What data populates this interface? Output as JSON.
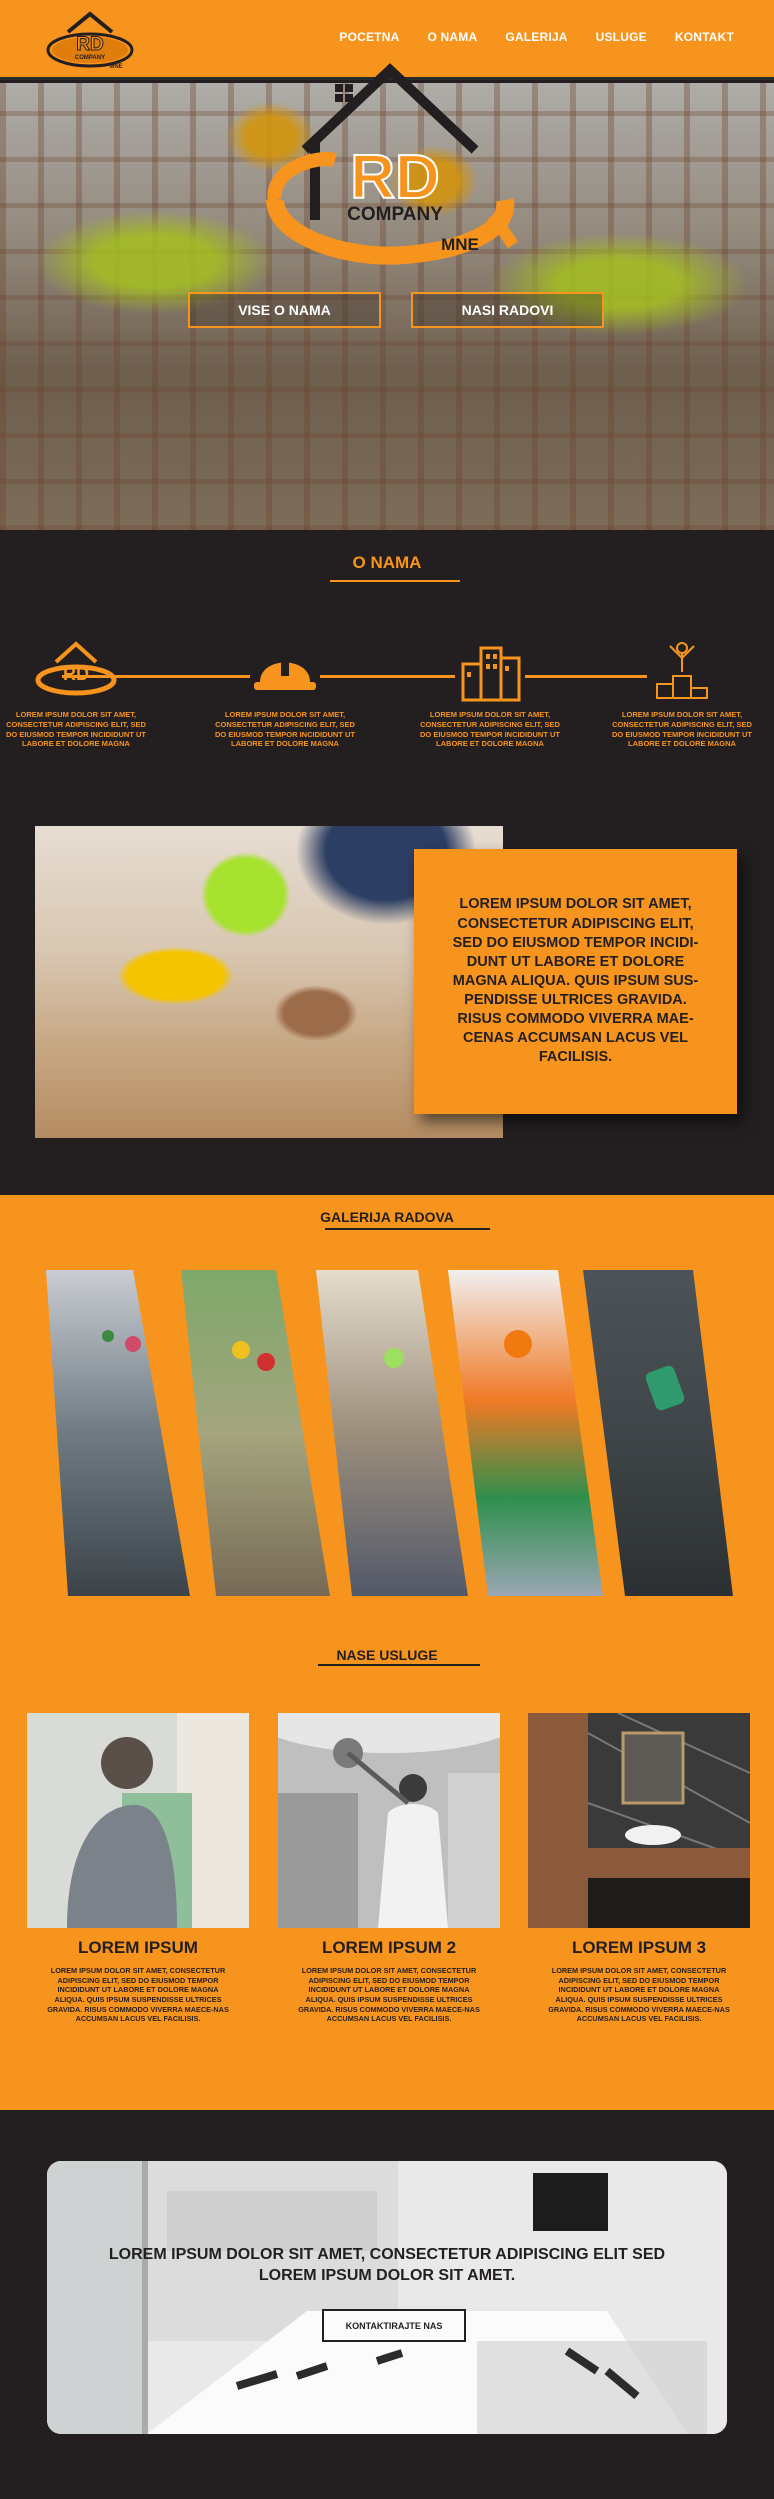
{
  "brand": {
    "logo_letters": "RD",
    "logo_word": "COMPANY",
    "logo_suffix": "MNE",
    "accent": "#f7941d",
    "dark": "#231f20"
  },
  "nav": {
    "items": [
      "POCETNA",
      "O NAMA",
      "GALERIJA",
      "USLUGE",
      "KONTAKT"
    ]
  },
  "hero": {
    "button_about": "VISE O NAMA",
    "button_work": "NASI RADOVI"
  },
  "about": {
    "title": "O NAMA",
    "features": [
      {
        "icon": "rd-logo-icon",
        "text": "LOREM IPSUM DOLOR SIT AMET, CONSECTETUR ADIPISCING ELIT, SED DO EIUSMOD TEMPOR INCIDIDUNT UT LABORE ET DOLORE MAGNA"
      },
      {
        "icon": "hard-hat-icon",
        "text": "LOREM IPSUM DOLOR SIT AMET, CONSECTETUR ADIPISCING ELIT, SED DO EIUSMOD TEMPOR INCIDIDUNT UT LABORE ET DOLORE MAGNA"
      },
      {
        "icon": "buildings-icon",
        "text": "LOREM IPSUM DOLOR SIT AMET, CONSECTETUR ADIPISCING ELIT, SED DO EIUSMOD TEMPOR INCIDIDUNT UT LABORE ET DOLORE MAGNA"
      },
      {
        "icon": "winner-podium-icon",
        "text": "LOREM IPSUM DOLOR SIT AMET, CONSECTETUR ADIPISCING ELIT, SED DO EIUSMOD TEMPOR INCIDIDUNT UT LABORE ET DOLORE MAGNA"
      }
    ],
    "highlight_text": "LOREM IPSUM DOLOR SIT AMET, CONSECTETUR ADIPISCING ELIT, SED DO EIUSMOD TEMPOR INCIDI-DUNT UT LABORE ET DOLORE MAGNA ALIQUA. QUIS IPSUM SUS-PENDISSE ULTRICES GRAVIDA. RISUS COMMODO VIVERRA MAE-CENAS ACCUMSAN LACUS VEL FACILISIS."
  },
  "gallery": {
    "title": "GALERIJA RADOVA"
  },
  "services": {
    "title": "NASE USLUGE",
    "items": [
      {
        "title": "LOREM IPSUM",
        "text": "LOREM IPSUM DOLOR SIT AMET, CONSECTETUR ADIPISCING ELIT, SED DO EIUSMOD TEMPOR INCIDIDUNT UT LABORE ET DOLORE MAGNA ALIQUA. QUIS IPSUM SUSPENDISSE ULTRICES GRAVIDA. RISUS COMMODO VIVERRA MAECE-NAS ACCUMSAN LACUS VEL FACILISIS."
      },
      {
        "title": "LOREM IPSUM 2",
        "text": "LOREM IPSUM DOLOR SIT AMET, CONSECTETUR ADIPISCING ELIT, SED DO EIUSMOD TEMPOR INCIDIDUNT UT LABORE ET DOLORE MAGNA ALIQUA. QUIS IPSUM SUSPENDISSE ULTRICES GRAVIDA. RISUS COMMODO VIVERRA MAECE-NAS ACCUMSAN LACUS VEL FACILISIS."
      },
      {
        "title": "LOREM IPSUM 3",
        "text": "LOREM IPSUM DOLOR SIT AMET, CONSECTETUR ADIPISCING ELIT, SED DO EIUSMOD TEMPOR INCIDIDUNT UT LABORE ET DOLORE MAGNA ALIQUA. QUIS IPSUM SUSPENDISSE ULTRICES GRAVIDA. RISUS COMMODO VIVERRA MAECE-NAS ACCUMSAN LACUS VEL FACILISIS."
      }
    ]
  },
  "contact": {
    "text": "LOREM IPSUM DOLOR SIT AMET, CONSECTETUR ADIPISCING ELIT SED LOREM IPSUM DOLOR SIT AMET.",
    "button": "KONTAKTIRAJTE NAS"
  }
}
